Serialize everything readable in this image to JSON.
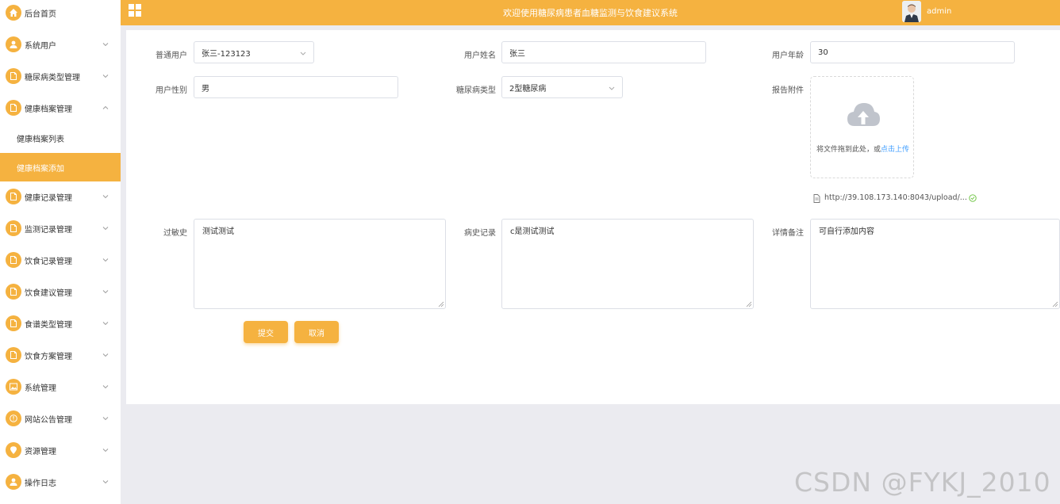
{
  "sidebar": {
    "home": "后台首页",
    "items": [
      {
        "label": "系统用户",
        "icon": "user-icon"
      },
      {
        "label": "糖尿病类型管理",
        "icon": "file-icon"
      },
      {
        "label": "健康档案管理",
        "icon": "file-icon",
        "expanded": true
      },
      {
        "label": "健康记录管理",
        "icon": "file-icon"
      },
      {
        "label": "监测记录管理",
        "icon": "file-icon"
      },
      {
        "label": "饮食记录管理",
        "icon": "file-icon"
      },
      {
        "label": "饮食建议管理",
        "icon": "file-icon"
      },
      {
        "label": "食谱类型管理",
        "icon": "file-icon"
      },
      {
        "label": "饮食方案管理",
        "icon": "file-icon"
      },
      {
        "label": "系统管理",
        "icon": "picture-icon"
      },
      {
        "label": "网站公告管理",
        "icon": "info-icon"
      },
      {
        "label": "资源管理",
        "icon": "location-icon"
      },
      {
        "label": "操作日志",
        "icon": "user-icon"
      }
    ],
    "sub": [
      {
        "label": "健康档案列表",
        "active": false
      },
      {
        "label": "健康档案添加",
        "active": true
      }
    ]
  },
  "header": {
    "title": "欢迎使用糖尿病患者血糖监测与饮食建议系统",
    "username": "admin"
  },
  "form": {
    "user_label": "普通用户",
    "user_value": "张三-123123",
    "name_label": "用户姓名",
    "name_value": "张三",
    "age_label": "用户年龄",
    "age_value": "30",
    "gender_label": "用户性别",
    "gender_value": "男",
    "type_label": "糖尿病类型",
    "type_value": "2型糖尿病",
    "attachment_label": "报告附件",
    "upload_hint": "将文件拖到此处，或",
    "upload_link": "点击上传",
    "file_name": "http://39.108.173.140:8043/upload/...",
    "allergy_label": "过敏史",
    "allergy_value": "测试测试",
    "history_label": "病史记录",
    "history_value": "c是测试测试",
    "notes_label": "详情备注",
    "notes_value": "可自行添加内容",
    "submit_label": "提交",
    "cancel_label": "取消"
  },
  "watermark": "CSDN @FYKJ_2010",
  "colors": {
    "accent": "#f5b240",
    "link": "#409eff",
    "success": "#67c23a"
  }
}
